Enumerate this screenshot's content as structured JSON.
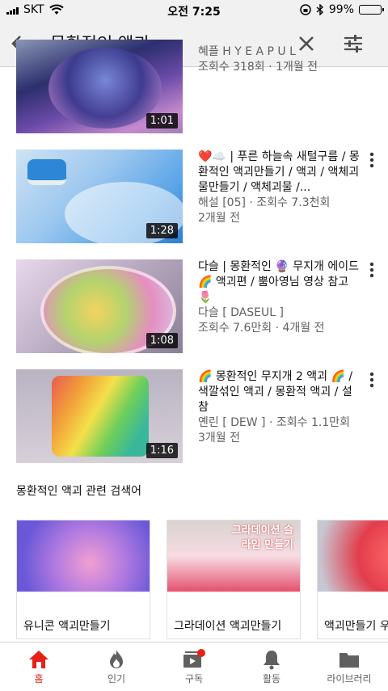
{
  "status": {
    "carrier": "SKT",
    "time": "오전 7:25",
    "battery": "99%",
    "battery_level": 0.99
  },
  "search": {
    "query": "몽환적인 액괴",
    "back_icon": "arrow-left-icon",
    "clear_icon": "close-icon",
    "filter_icon": "filter-sliders-icon"
  },
  "results": [
    {
      "title": "",
      "channel": "혜플 H Y E A P U L",
      "meta": "조회수 318회 · 1개월 전",
      "duration": "1:01"
    },
    {
      "title": "❤️☁️ | 푸른 하늘속 새털구름 / 몽환적인 액괴만들기 / 액괴 / 액체괴물만들기 / 액체괴물 /...",
      "channel": "해설 [05] · 조회수 7.3천회",
      "meta": "2개월 전",
      "duration": "1:28"
    },
    {
      "title": "다슬 | 몽환적인 🔮 무지개 에이드 🌈 액괴편 / 뿜아영님 영상 참고 🌷",
      "channel": "다슬 [ DASEUL ]",
      "meta": "조회수 7.6만회 · 4개월 전",
      "duration": "1:08"
    },
    {
      "title": "🌈 몽환적인 무지개 2 액괴 🌈 / 색깔섞인 액괴 / 몽환적 액괴 / 설참",
      "channel": "옌린 [ DEW ] · 조회수 1.1만회",
      "meta": "3개월 전",
      "duration": "1:16"
    }
  ],
  "related": {
    "heading": "몽환적인 액괴 관련 검색어",
    "items": [
      {
        "label": "유니콘 액괴만들기",
        "overlay": ""
      },
      {
        "label": "그라데이션 액괴만들기",
        "overlay": "그라데이션 슬라임 만들기"
      },
      {
        "label": "액괴만들기 우",
        "overlay": ""
      }
    ]
  },
  "nav": [
    {
      "label": "홈",
      "icon": "home-icon",
      "active": true
    },
    {
      "label": "인기",
      "icon": "flame-icon",
      "active": false
    },
    {
      "label": "구독",
      "icon": "subscriptions-icon",
      "active": false
    },
    {
      "label": "활동",
      "icon": "bell-icon",
      "active": false
    },
    {
      "label": "라이브러리",
      "icon": "folder-icon",
      "active": false
    }
  ],
  "colors": {
    "accent": "#e62117",
    "header_bg": "#f1f1f1"
  }
}
